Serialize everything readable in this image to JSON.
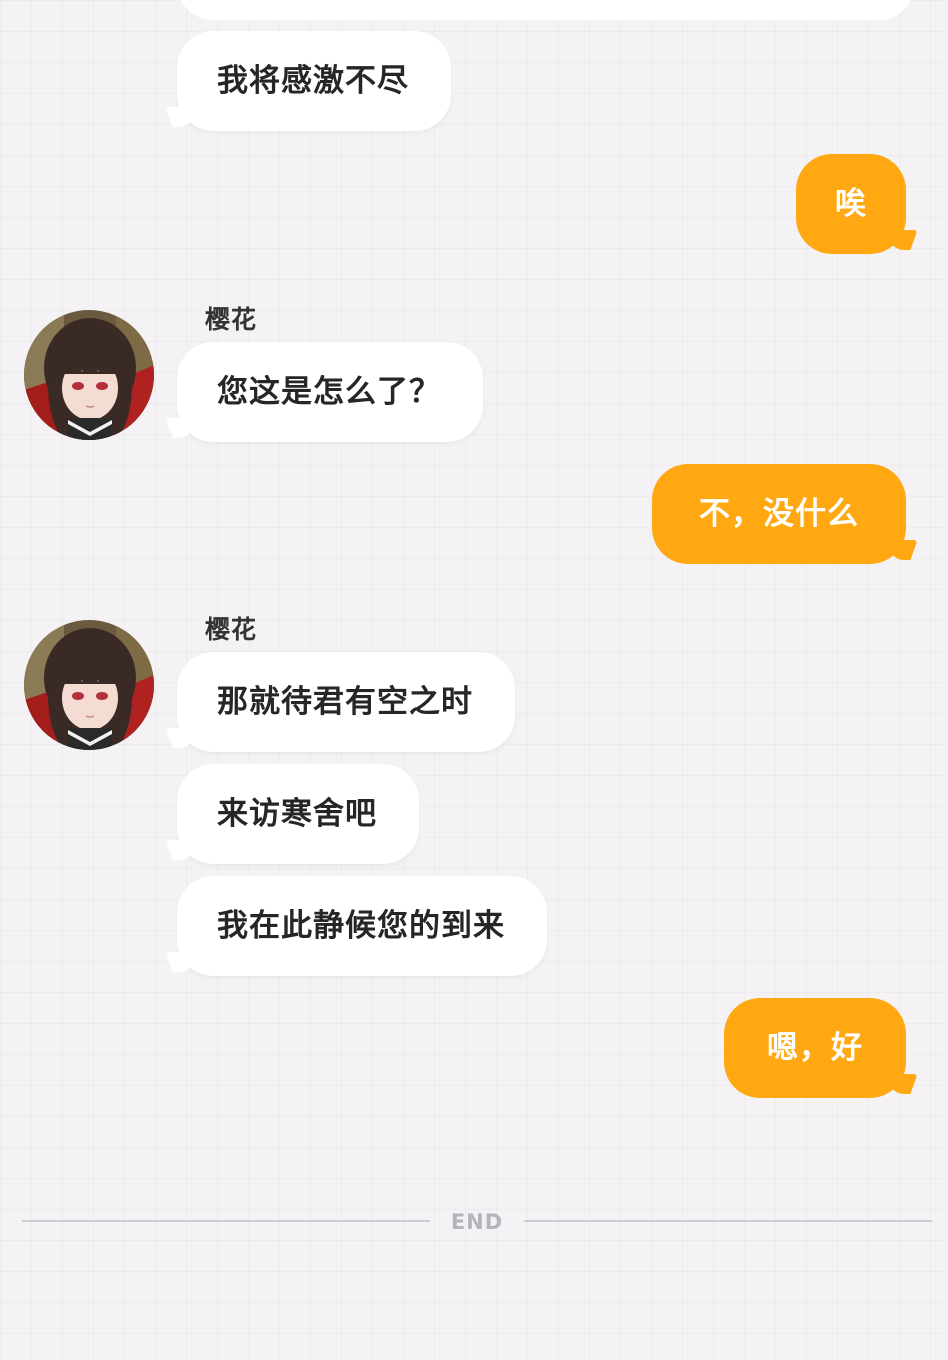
{
  "conversation": {
    "sender_name": "樱花",
    "messages": [
      {
        "side": "left",
        "text": "我将感激不尽"
      },
      {
        "side": "right",
        "text": "唉"
      },
      {
        "side": "left",
        "text": "您这是怎么了？"
      },
      {
        "side": "right",
        "text": "不，没什么"
      },
      {
        "side": "left",
        "text": "那就待君有空之时"
      },
      {
        "side": "left",
        "text": "来访寒舍吧"
      },
      {
        "side": "left",
        "text": "我在此静候您的到来"
      },
      {
        "side": "right",
        "text": "嗯，好"
      }
    ],
    "end_label": "END"
  },
  "colors": {
    "background": "#f4f2f4",
    "left_bubble": "#ffffff",
    "right_bubble": "#ffa812",
    "left_text": "#262626",
    "right_text": "#ffffff"
  },
  "icons": {
    "avatar": "character-avatar-sakura"
  }
}
